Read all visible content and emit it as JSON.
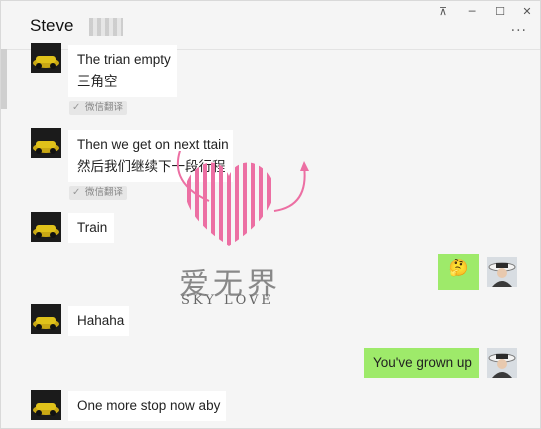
{
  "window": {
    "title": "Steve",
    "controls": {
      "pin": "⊼",
      "minimize": "─",
      "maximize": "☐",
      "close": "✕"
    },
    "more_icon": "more-icon",
    "more_label": "···"
  },
  "colors": {
    "sent_bubble": "#9eea6a",
    "received_bubble": "#ffffff",
    "background": "#f5f5f5"
  },
  "messages": [
    {
      "from": "Steve",
      "lines": [
        "The trian empty",
        "三角空"
      ],
      "translate_label": "微信翻译"
    },
    {
      "from": "Steve",
      "lines": [
        "Then we get on next ttain",
        "然后我们继续下一段行程"
      ],
      "translate_label": "微信翻译"
    },
    {
      "from": "Steve",
      "lines": [
        "Train"
      ]
    },
    {
      "from": "me",
      "lines": [
        "🤔"
      ]
    },
    {
      "from": "Steve",
      "lines": [
        "Hahaha"
      ]
    },
    {
      "from": "me",
      "lines": [
        "You've grown up"
      ]
    },
    {
      "from": "Steve",
      "lines": [
        "One more stop now  aby"
      ]
    }
  ],
  "watermark": {
    "cn": "爱无界",
    "en": "SKY LOVE"
  }
}
